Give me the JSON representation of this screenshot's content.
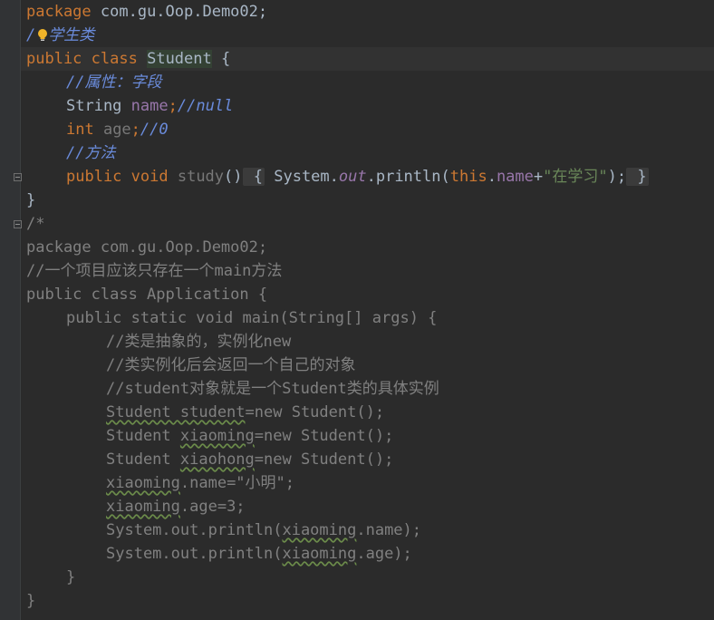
{
  "editor": {
    "code1": {
      "l1_pkg": "package",
      "l1_rest": " com.gu.Oop.Demo02;",
      "l2_slash": "/",
      "l2_comment": "学生类",
      "l3_public": "public",
      "l3_class": " class",
      "l3_name": "Student",
      "l3_brace": " {",
      "l4_comment": "//属性：字段",
      "l5_type": "String ",
      "l5_field": "name",
      "l5_semi": ";",
      "l5_comment": "//null",
      "l6_type": "int",
      "l6_field": " age",
      "l6_semi": ";",
      "l6_comment": "//0",
      "l7_comment": "//方法",
      "l8_public": "public",
      "l8_void": " void",
      "l8_method": " study",
      "l8_paren": "()",
      "l8_open": " {",
      "l8_system": " System.",
      "l8_out": "out",
      "l8_println": ".println(",
      "l8_this": "this",
      "l8_dot": ".",
      "l8_name": "name",
      "l8_plus": "+",
      "l8_str": "\"在学习\"",
      "l8_close_paren": ");",
      "l8_close": " }",
      "l9_brace": "}",
      "l10_comment_open": "/*"
    },
    "code2": {
      "l11": "package com.gu.Oop.Demo02;",
      "l12": "//一个项目应该只存在一个main方法",
      "l13": "public class Application {",
      "l14": "public static void main(String[] args) {",
      "l15": "//类是抽象的，实例化new",
      "l16": "//类实例化后会返回一个自己的对象",
      "l17": "//student对象就是一个Student类的具体实例",
      "l18_a": "Student student",
      "l18_b": "=new Student();",
      "l19_a": "Student ",
      "l19_b": "xiaoming",
      "l19_c": "=new Student();",
      "l20_a": "Student ",
      "l20_b": "xiaohong",
      "l20_c": "=new Student();",
      "l21_a": "xiaoming",
      "l21_b": ".name=\"小明\";",
      "l22_a": "xiaoming",
      "l22_b": ".age=3;",
      "l23_a": "System.out.println(",
      "l23_b": "xiaoming",
      "l23_c": ".name);",
      "l24_a": "System.out.println(",
      "l24_b": "xiaoming",
      "l24_c": ".age);",
      "l25": "}",
      "l26": "}"
    }
  },
  "colors": {
    "background": "#2b2b2b",
    "keyword": "#cc7832",
    "field": "#9876aa",
    "string": "#6a8759",
    "comment": "#629755",
    "text": "#a9b7c6"
  },
  "icons": {
    "gutter_bulb": "lightbulb-icon",
    "fold": "fold-icon"
  }
}
